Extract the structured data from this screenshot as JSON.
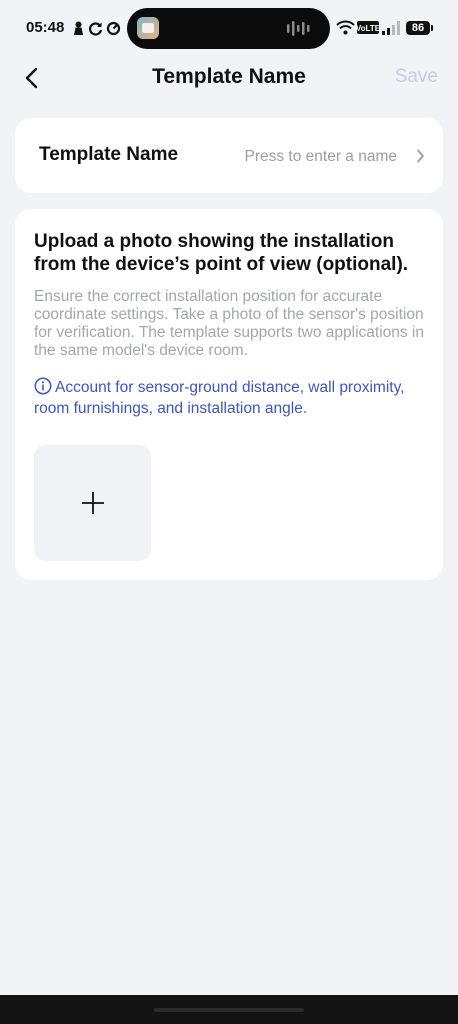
{
  "status_bar": {
    "time": "05:48",
    "battery": "86"
  },
  "nav": {
    "title": "Template Name",
    "save_label": "Save"
  },
  "name_row": {
    "label": "Template Name",
    "placeholder": "Press to enter a name"
  },
  "photo_section": {
    "heading": "Upload a photo showing the installation from the device’s point of view (optional).",
    "description": "Ensure the correct installation position for accurate coordinate settings. Take a photo of the sensor's position for verification. The template supports two applications in the same model's device room.",
    "note": "Account for sensor-ground distance, wall proximity, room furnishings, and installation angle."
  },
  "colors": {
    "background": "#f2f3f7",
    "card": "#ffffff",
    "accent_blue": "#3d55c6",
    "save_disabled": "#c4cbe8",
    "muted_text": "#a3a6ab"
  },
  "icons": [
    "person-icon",
    "sync-icon",
    "refresh-icon",
    "voice-wave-icon",
    "wifi-icon",
    "volte-icon",
    "signal-icon",
    "battery-icon",
    "back-arrow-icon",
    "chevron-right-icon",
    "info-icon",
    "plus-icon"
  ]
}
